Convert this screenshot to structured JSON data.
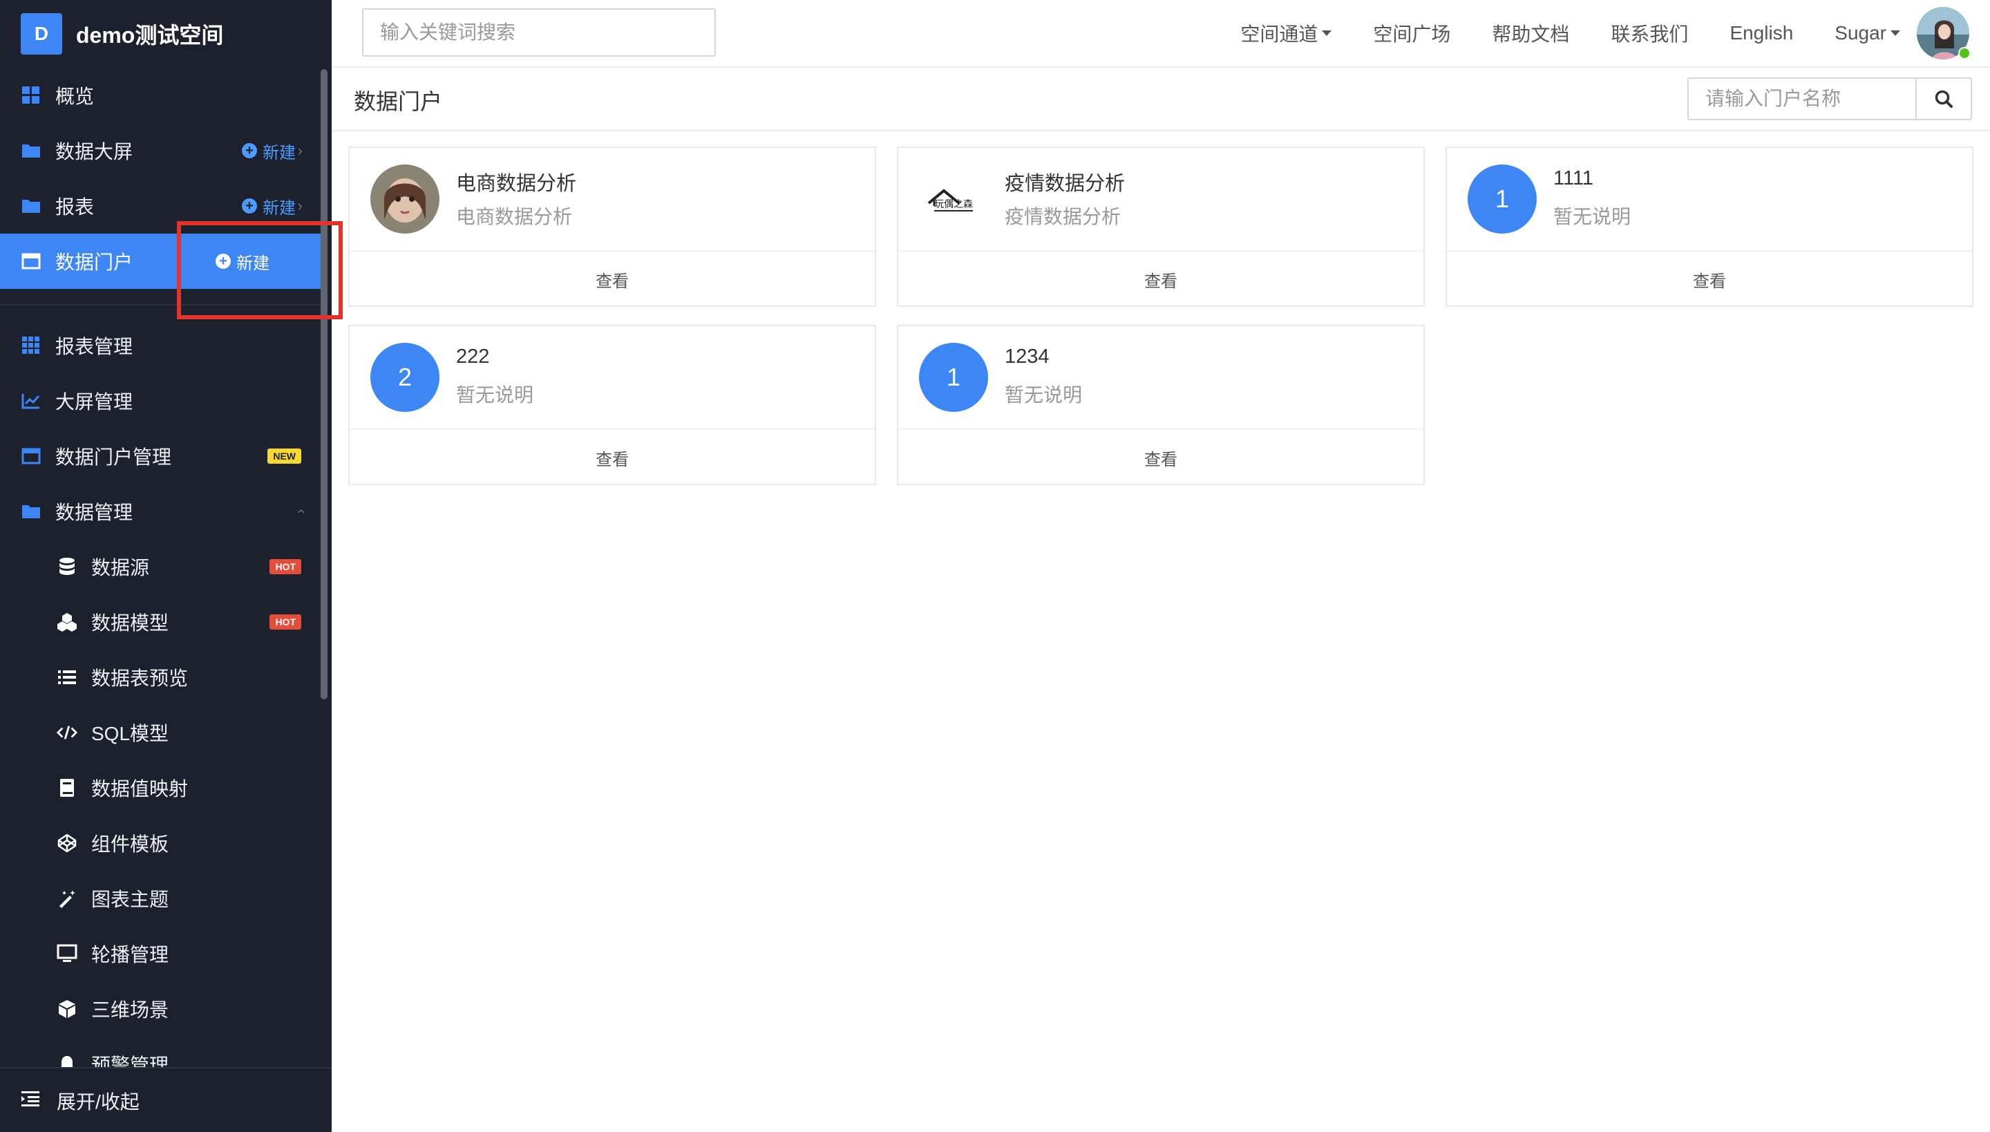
{
  "brand": {
    "logo_letter": "D",
    "name": "demo测试空间",
    "logo_color": "#3d86f6"
  },
  "sidebar": {
    "items": [
      {
        "label": "概览",
        "icon": "grid-icon"
      },
      {
        "label": "数据大屏",
        "icon": "folder-icon",
        "new_label": "新建"
      },
      {
        "label": "报表",
        "icon": "folder-icon",
        "new_label": "新建"
      },
      {
        "label": "数据门户",
        "icon": "window-icon",
        "new_label": "新建",
        "active": true
      },
      {
        "label": "报表管理",
        "icon": "apps-icon"
      },
      {
        "label": "大屏管理",
        "icon": "line-chart-icon"
      },
      {
        "label": "数据门户管理",
        "icon": "window-icon",
        "badge": "NEW"
      },
      {
        "label": "数据管理",
        "icon": "folder-icon",
        "expanded": true
      },
      {
        "label": "数据源",
        "icon": "database-icon",
        "badge": "HOT"
      },
      {
        "label": "数据模型",
        "icon": "cubes-icon",
        "badge": "HOT"
      },
      {
        "label": "数据表预览",
        "icon": "list-icon"
      },
      {
        "label": "SQL模型",
        "icon": "code-icon"
      },
      {
        "label": "数据值映射",
        "icon": "book-icon"
      },
      {
        "label": "组件模板",
        "icon": "codepen-icon"
      },
      {
        "label": "图表主题",
        "icon": "magic-icon"
      },
      {
        "label": "轮播管理",
        "icon": "monitor-icon"
      },
      {
        "label": "三维场景",
        "icon": "cube-icon"
      },
      {
        "label": "预警管理",
        "icon": "bell-icon"
      }
    ],
    "footer_label": "展开/收起"
  },
  "header": {
    "search_placeholder": "输入关键词搜索",
    "links": [
      "空间通道",
      "空间广场",
      "帮助文档",
      "联系我们",
      "English",
      "Sugar"
    ]
  },
  "page": {
    "title": "数据门户",
    "search_placeholder": "请输入门户名称"
  },
  "portals": [
    {
      "name": "电商数据分析",
      "desc": "电商数据分析",
      "thumb": "photo",
      "view": "查看"
    },
    {
      "name": "疫情数据分析",
      "desc": "疫情数据分析",
      "thumb": "logo",
      "logo_text": "玩偶之森",
      "view": "查看"
    },
    {
      "name": "1111",
      "desc": "暂无说明",
      "thumb_num": "1",
      "view": "查看"
    },
    {
      "name": "222",
      "desc": "暂无说明",
      "thumb_num": "2",
      "view": "查看"
    },
    {
      "name": "1234",
      "desc": "暂无说明",
      "thumb_num": "1",
      "view": "查看"
    }
  ],
  "colors": {
    "accent": "#3d86f6",
    "sidebar_bg": "#1d212e",
    "highlight": "#e5332a",
    "hot": "#e54d3b",
    "new": "#f8d92f"
  }
}
